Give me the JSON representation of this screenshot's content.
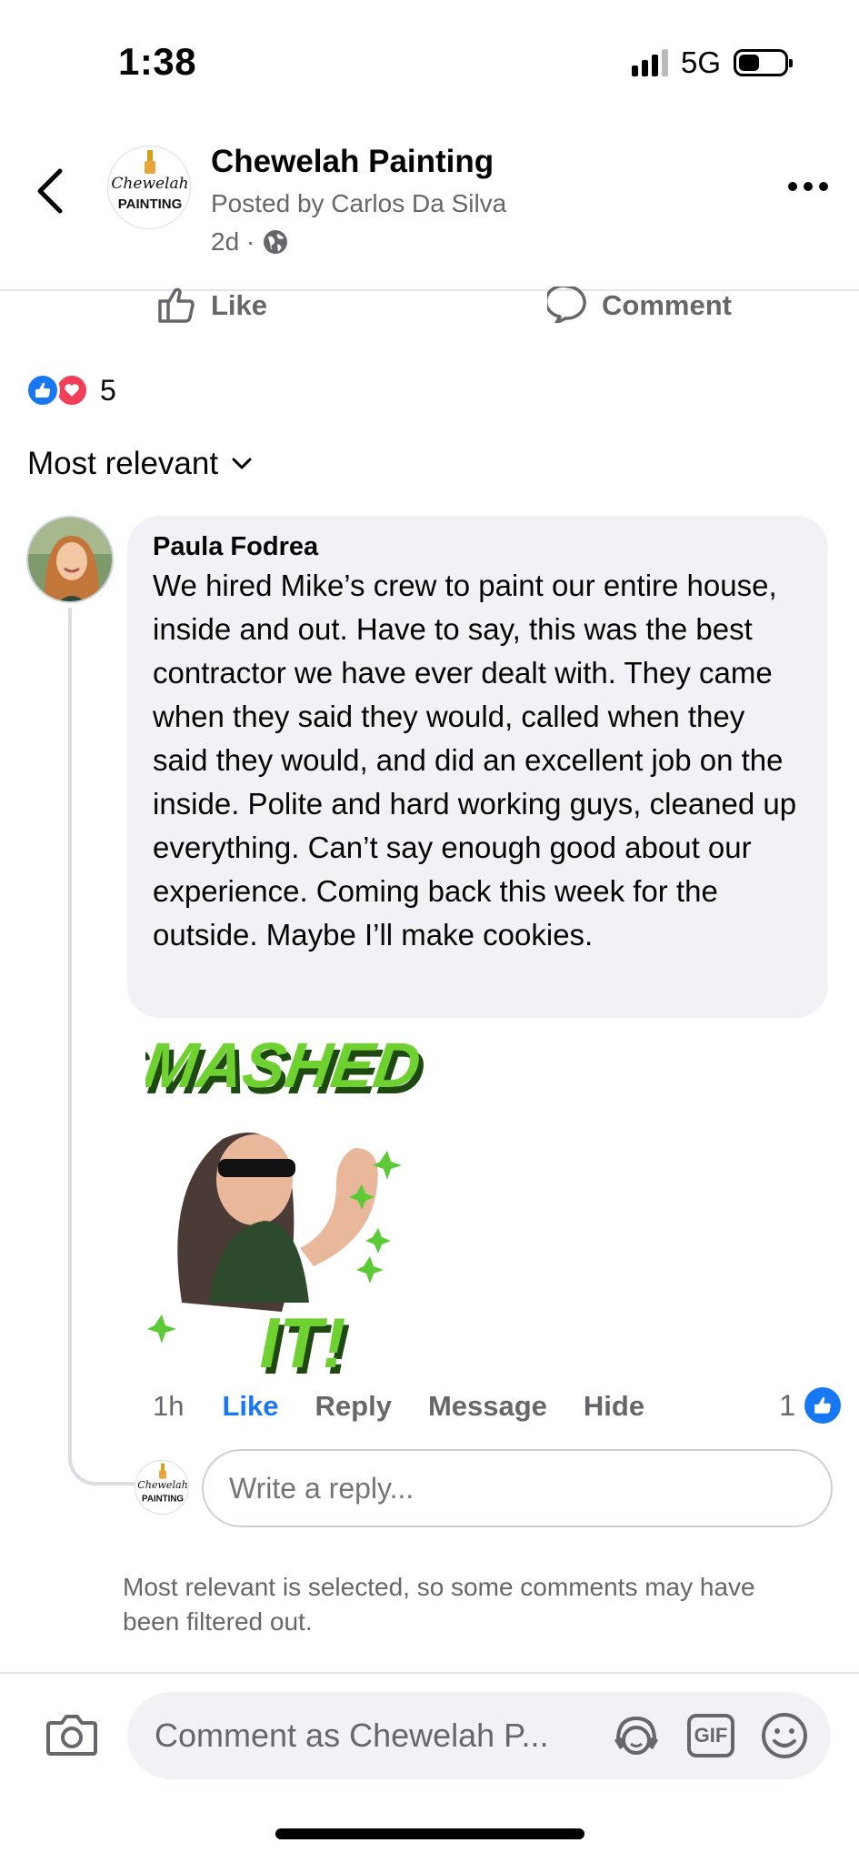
{
  "status_bar": {
    "time": "1:38",
    "network": "5G"
  },
  "header": {
    "page_name": "Chewelah Painting",
    "posted_by": "Posted by Carlos Da Silva",
    "age": "2d ·",
    "logo_text_top": "Chewelah",
    "logo_text_bottom": "PAINTING"
  },
  "actions": {
    "like_label": "Like",
    "comment_label": "Comment"
  },
  "reactions": {
    "count": "5"
  },
  "sort": {
    "label": "Most relevant"
  },
  "comment": {
    "author": "Paula Fodrea",
    "text": "We hired Mike’s crew to paint our entire house, inside and out. Have to say, this was the best contractor we have ever dealt with. They came when they said they would, called when they said they would, and did an excellent job on the inside. Polite and hard working guys, cleaned up everything. Can’t say enough good about our experience. Coming back this week for the outside. Maybe I’ll make cookies.",
    "sticker_top": "SMASHED",
    "sticker_bottom": "IT!",
    "age": "1h",
    "like_label": "Like",
    "reply_label": "Reply",
    "message_label": "Message",
    "hide_label": "Hide",
    "like_count": "1"
  },
  "reply": {
    "placeholder": "Write a reply..."
  },
  "notice": "Most relevant is selected, so some comments may have been filtered out.",
  "composer": {
    "placeholder": "Comment as Chewelah P...",
    "gif_label": "GIF"
  },
  "colors": {
    "accent": "#1877f2",
    "love": "#f33e58",
    "bubble": "#f0f2f5",
    "muted": "#65676b"
  }
}
